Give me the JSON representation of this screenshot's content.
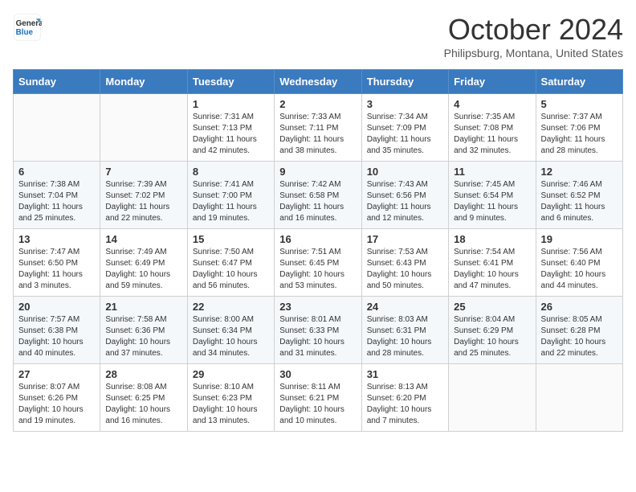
{
  "header": {
    "logo_general": "General",
    "logo_blue": "Blue",
    "month_title": "October 2024",
    "location": "Philipsburg, Montana, United States"
  },
  "days_of_week": [
    "Sunday",
    "Monday",
    "Tuesday",
    "Wednesday",
    "Thursday",
    "Friday",
    "Saturday"
  ],
  "weeks": [
    [
      {
        "day": "",
        "info": ""
      },
      {
        "day": "",
        "info": ""
      },
      {
        "day": "1",
        "info": "Sunrise: 7:31 AM\nSunset: 7:13 PM\nDaylight: 11 hours and 42 minutes."
      },
      {
        "day": "2",
        "info": "Sunrise: 7:33 AM\nSunset: 7:11 PM\nDaylight: 11 hours and 38 minutes."
      },
      {
        "day": "3",
        "info": "Sunrise: 7:34 AM\nSunset: 7:09 PM\nDaylight: 11 hours and 35 minutes."
      },
      {
        "day": "4",
        "info": "Sunrise: 7:35 AM\nSunset: 7:08 PM\nDaylight: 11 hours and 32 minutes."
      },
      {
        "day": "5",
        "info": "Sunrise: 7:37 AM\nSunset: 7:06 PM\nDaylight: 11 hours and 28 minutes."
      }
    ],
    [
      {
        "day": "6",
        "info": "Sunrise: 7:38 AM\nSunset: 7:04 PM\nDaylight: 11 hours and 25 minutes."
      },
      {
        "day": "7",
        "info": "Sunrise: 7:39 AM\nSunset: 7:02 PM\nDaylight: 11 hours and 22 minutes."
      },
      {
        "day": "8",
        "info": "Sunrise: 7:41 AM\nSunset: 7:00 PM\nDaylight: 11 hours and 19 minutes."
      },
      {
        "day": "9",
        "info": "Sunrise: 7:42 AM\nSunset: 6:58 PM\nDaylight: 11 hours and 16 minutes."
      },
      {
        "day": "10",
        "info": "Sunrise: 7:43 AM\nSunset: 6:56 PM\nDaylight: 11 hours and 12 minutes."
      },
      {
        "day": "11",
        "info": "Sunrise: 7:45 AM\nSunset: 6:54 PM\nDaylight: 11 hours and 9 minutes."
      },
      {
        "day": "12",
        "info": "Sunrise: 7:46 AM\nSunset: 6:52 PM\nDaylight: 11 hours and 6 minutes."
      }
    ],
    [
      {
        "day": "13",
        "info": "Sunrise: 7:47 AM\nSunset: 6:50 PM\nDaylight: 11 hours and 3 minutes."
      },
      {
        "day": "14",
        "info": "Sunrise: 7:49 AM\nSunset: 6:49 PM\nDaylight: 10 hours and 59 minutes."
      },
      {
        "day": "15",
        "info": "Sunrise: 7:50 AM\nSunset: 6:47 PM\nDaylight: 10 hours and 56 minutes."
      },
      {
        "day": "16",
        "info": "Sunrise: 7:51 AM\nSunset: 6:45 PM\nDaylight: 10 hours and 53 minutes."
      },
      {
        "day": "17",
        "info": "Sunrise: 7:53 AM\nSunset: 6:43 PM\nDaylight: 10 hours and 50 minutes."
      },
      {
        "day": "18",
        "info": "Sunrise: 7:54 AM\nSunset: 6:41 PM\nDaylight: 10 hours and 47 minutes."
      },
      {
        "day": "19",
        "info": "Sunrise: 7:56 AM\nSunset: 6:40 PM\nDaylight: 10 hours and 44 minutes."
      }
    ],
    [
      {
        "day": "20",
        "info": "Sunrise: 7:57 AM\nSunset: 6:38 PM\nDaylight: 10 hours and 40 minutes."
      },
      {
        "day": "21",
        "info": "Sunrise: 7:58 AM\nSunset: 6:36 PM\nDaylight: 10 hours and 37 minutes."
      },
      {
        "day": "22",
        "info": "Sunrise: 8:00 AM\nSunset: 6:34 PM\nDaylight: 10 hours and 34 minutes."
      },
      {
        "day": "23",
        "info": "Sunrise: 8:01 AM\nSunset: 6:33 PM\nDaylight: 10 hours and 31 minutes."
      },
      {
        "day": "24",
        "info": "Sunrise: 8:03 AM\nSunset: 6:31 PM\nDaylight: 10 hours and 28 minutes."
      },
      {
        "day": "25",
        "info": "Sunrise: 8:04 AM\nSunset: 6:29 PM\nDaylight: 10 hours and 25 minutes."
      },
      {
        "day": "26",
        "info": "Sunrise: 8:05 AM\nSunset: 6:28 PM\nDaylight: 10 hours and 22 minutes."
      }
    ],
    [
      {
        "day": "27",
        "info": "Sunrise: 8:07 AM\nSunset: 6:26 PM\nDaylight: 10 hours and 19 minutes."
      },
      {
        "day": "28",
        "info": "Sunrise: 8:08 AM\nSunset: 6:25 PM\nDaylight: 10 hours and 16 minutes."
      },
      {
        "day": "29",
        "info": "Sunrise: 8:10 AM\nSunset: 6:23 PM\nDaylight: 10 hours and 13 minutes."
      },
      {
        "day": "30",
        "info": "Sunrise: 8:11 AM\nSunset: 6:21 PM\nDaylight: 10 hours and 10 minutes."
      },
      {
        "day": "31",
        "info": "Sunrise: 8:13 AM\nSunset: 6:20 PM\nDaylight: 10 hours and 7 minutes."
      },
      {
        "day": "",
        "info": ""
      },
      {
        "day": "",
        "info": ""
      }
    ]
  ]
}
